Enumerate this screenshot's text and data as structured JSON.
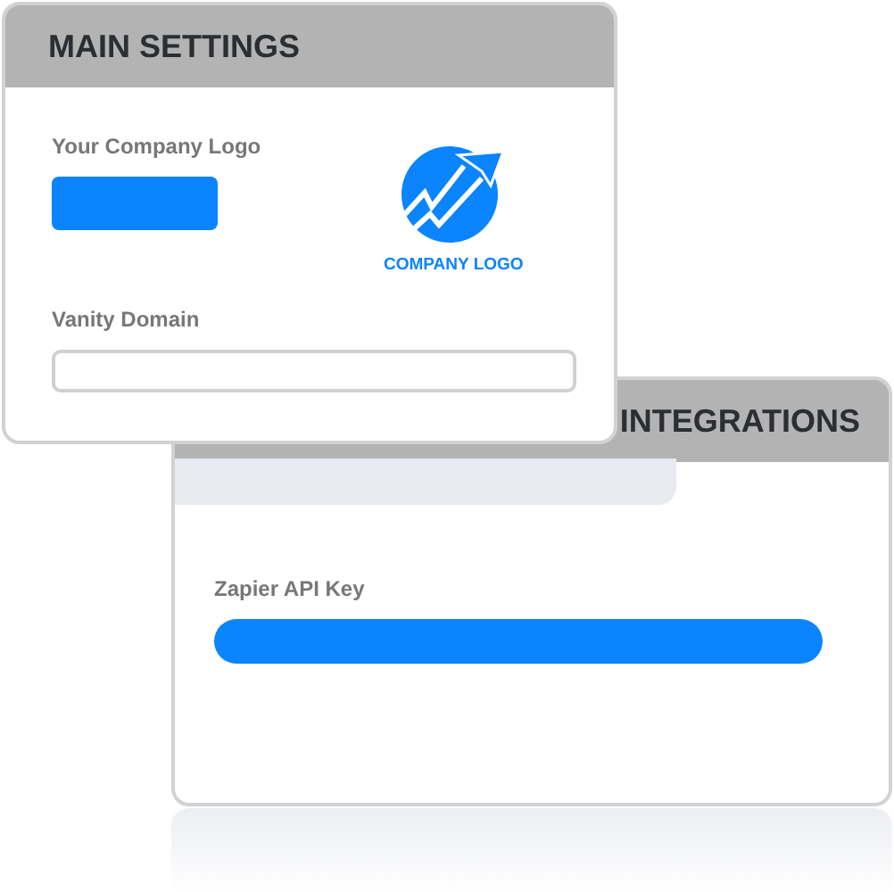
{
  "main_settings": {
    "title": "MAIN SETTINGS",
    "logo_label": "Your Company Logo",
    "logo_caption": "COMPANY LOGO",
    "vanity_label": "Vanity Domain"
  },
  "integrations": {
    "title": "INTEGRATIONS",
    "api_key_label": "Zapier API Key"
  }
}
